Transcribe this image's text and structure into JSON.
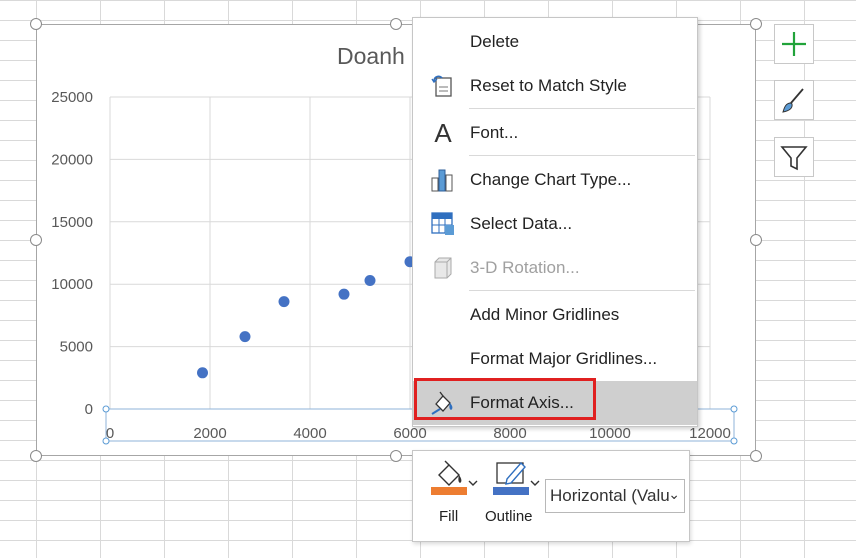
{
  "chart": {
    "title": "Doanh"
  },
  "chart_data": {
    "type": "scatter",
    "title": "Doanh",
    "x_ticks": [
      "0",
      "2000",
      "4000",
      "6000",
      "8000",
      "10000",
      "12000"
    ],
    "y_ticks": [
      "25000",
      "20000",
      "15000",
      "10000",
      "5000",
      "0"
    ],
    "xlim": [
      0,
      12000
    ],
    "ylim": [
      0,
      25000
    ],
    "grid": true,
    "points": [
      {
        "x": 1850,
        "y": 2900
      },
      {
        "x": 2700,
        "y": 5800
      },
      {
        "x": 3480,
        "y": 8600
      },
      {
        "x": 4680,
        "y": 9200
      },
      {
        "x": 5200,
        "y": 10300
      },
      {
        "x": 6000,
        "y": 11800
      }
    ],
    "marker_color": "#4472c4"
  },
  "context_menu": {
    "items": [
      {
        "key": "delete",
        "label": "Delete",
        "icon": "none",
        "disabled": false
      },
      {
        "key": "reset",
        "label": "Reset to Match Style",
        "icon": "reset-style-icon",
        "disabled": false
      },
      {
        "key": "font",
        "label": "Font...",
        "icon": "font-icon",
        "disabled": false
      },
      {
        "key": "chart-type",
        "label": "Change Chart Type...",
        "icon": "chart-type-icon",
        "disabled": false
      },
      {
        "key": "select-data",
        "label": "Select Data...",
        "icon": "select-data-icon",
        "disabled": false
      },
      {
        "key": "rotation",
        "label": "3-D Rotation...",
        "icon": "3d-rotation-icon",
        "disabled": true
      },
      {
        "key": "minor-gridlines",
        "label": "Add Minor Gridlines",
        "icon": "none",
        "disabled": false
      },
      {
        "key": "major-gridlines",
        "label": "Format Major Gridlines...",
        "icon": "none",
        "disabled": false
      },
      {
        "key": "format-axis",
        "label": "Format Axis...",
        "icon": "format-axis-icon",
        "disabled": false,
        "highlighted": true
      }
    ]
  },
  "mini_toolbar": {
    "fill_label": "Fill",
    "outline_label": "Outline",
    "element_select": "Horizontal (Valu",
    "fill_color": "#ed7d31",
    "outline_color": "#4472c4"
  },
  "side_buttons": [
    "chart-elements-plus-icon",
    "chart-styles-brush-icon",
    "chart-filter-icon"
  ],
  "colors": {
    "accent": "#4472c4",
    "highlight_box": "#e02020",
    "plus": "#21a33a"
  }
}
